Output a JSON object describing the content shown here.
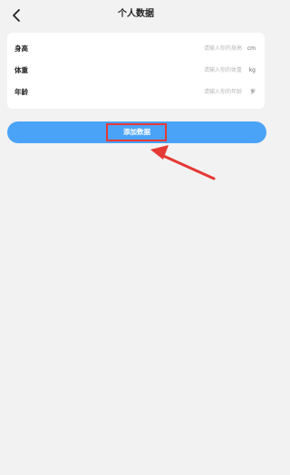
{
  "header": {
    "title": "个人数据",
    "back_icon": "chevron-left-icon"
  },
  "form": {
    "fields": [
      {
        "label": "身高",
        "placeholder": "请输入你的身高",
        "unit": "cm"
      },
      {
        "label": "体重",
        "placeholder": "请输入你的体重",
        "unit": "kg"
      },
      {
        "label": "年龄",
        "placeholder": "请输入你的年龄",
        "unit": "岁"
      }
    ]
  },
  "actions": {
    "add_label": "添加数据"
  },
  "annotation": {
    "highlight_color": "#e53935",
    "arrow_color": "#e53935"
  },
  "colors": {
    "accent": "#4aa3f7",
    "background": "#f2f2f2"
  }
}
